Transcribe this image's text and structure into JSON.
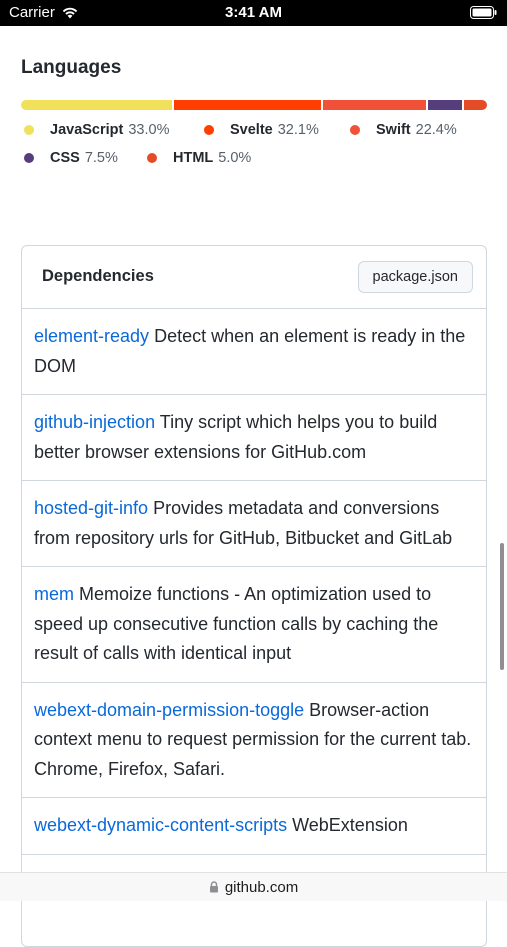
{
  "status_bar": {
    "carrier": "Carrier",
    "time": "3:41 AM"
  },
  "languages": {
    "title": "Languages",
    "items": [
      {
        "name": "JavaScript",
        "percent": "33.0%",
        "value": 33.0,
        "color": "#f1e05a"
      },
      {
        "name": "Svelte",
        "percent": "32.1%",
        "value": 32.1,
        "color": "#ff3e00"
      },
      {
        "name": "Swift",
        "percent": "22.4%",
        "value": 22.4,
        "color": "#f05138"
      },
      {
        "name": "CSS",
        "percent": "7.5%",
        "value": 7.5,
        "color": "#563d7c"
      },
      {
        "name": "HTML",
        "percent": "5.0%",
        "value": 5.0,
        "color": "#e34c26"
      }
    ]
  },
  "dependencies": {
    "title": "Dependencies",
    "package_button": "package.json",
    "items": [
      {
        "name": "element-ready",
        "description": "Detect when an element is ready in the DOM"
      },
      {
        "name": "github-injection",
        "description": "Tiny script which helps you to build better browser extensions for GitHub.com"
      },
      {
        "name": "hosted-git-info",
        "description": "Provides metadata and conversions from repository urls for GitHub, Bitbucket and GitLab"
      },
      {
        "name": "mem",
        "description": "Memoize functions - An optimization used to speed up consecutive function calls by caching the result of calls with identical input"
      },
      {
        "name": "webext-domain-permission-toggle",
        "description": "Browser-action context menu to request permission for the current tab. Chrome, Firefox, Safari."
      },
      {
        "name": "webext-dynamic-content-scripts",
        "description": "WebExtension"
      }
    ]
  },
  "url_bar": {
    "url": "github.com",
    "icon": "lock-icon"
  },
  "colors": {
    "link": "#0969da",
    "border": "#d0d7de"
  }
}
